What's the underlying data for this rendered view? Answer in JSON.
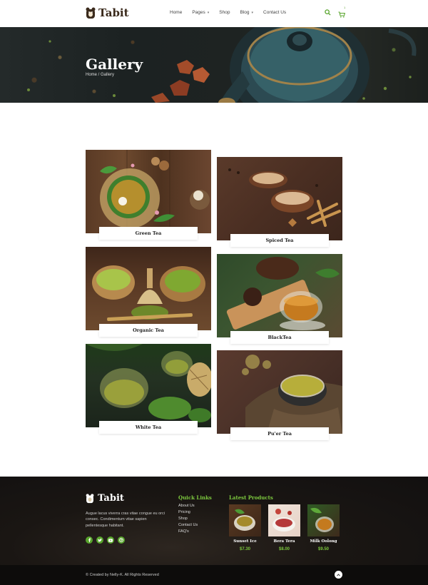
{
  "brand": {
    "name": "Tabit"
  },
  "nav": {
    "items": [
      {
        "label": "Home",
        "dropdown": false
      },
      {
        "label": "Pages",
        "dropdown": true
      },
      {
        "label": "Shop",
        "dropdown": false
      },
      {
        "label": "Blog",
        "dropdown": true
      },
      {
        "label": "Contact Us",
        "dropdown": false
      }
    ],
    "cart_count": "1",
    "icons": [
      "search-icon",
      "cart-icon"
    ]
  },
  "banner": {
    "title": "Gallery",
    "breadcrumb": "Home / Gallery"
  },
  "gallery": {
    "items": [
      {
        "caption": "Green Tea"
      },
      {
        "caption": "Spiced Tea"
      },
      {
        "caption": "Organic Tea"
      },
      {
        "caption": "BlackTea"
      },
      {
        "caption": "White Tea"
      },
      {
        "caption": "Pu'er Tea"
      }
    ]
  },
  "footer": {
    "brand": "Tabit",
    "description": "Augue lacus viverra cras vitae congue eu orci consec. Condimentum vitae sapien pellentesque habitant.",
    "social_icons": [
      "facebook-icon",
      "twitter-icon",
      "youtube-icon",
      "dribbble-icon"
    ],
    "quick_links_title": "Quick Links",
    "quick_links": [
      "About Us",
      "Pricing",
      "Shop",
      "Contact Us",
      "FAQ's"
    ],
    "latest_title": "Latest Products",
    "products": [
      {
        "name": "Sunset Ice",
        "price": "$7.30"
      },
      {
        "name": "Bera Tera",
        "price": "$8.00"
      },
      {
        "name": "Milk Oolong",
        "price": "$9.50"
      }
    ],
    "copyright": "© Created by Nelly-K. All Rights Reserved"
  },
  "colors": {
    "accent": "#58a42c",
    "dark": "#3a2a1c"
  }
}
